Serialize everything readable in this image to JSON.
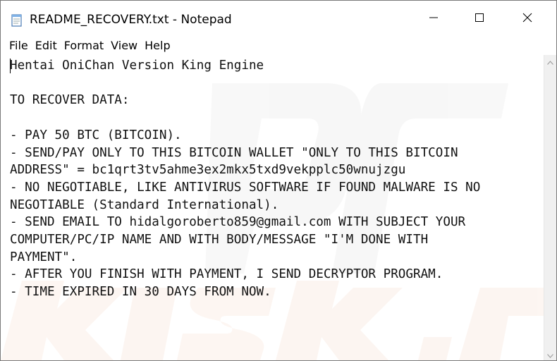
{
  "window": {
    "title": "README_RECOVERY.txt - Notepad",
    "app_icon": "notepad-icon",
    "controls": [
      "minimize-icon",
      "maximize-icon",
      "close-icon"
    ]
  },
  "menu": {
    "items": [
      "File",
      "Edit",
      "Format",
      "View",
      "Help"
    ]
  },
  "document": {
    "lines": [
      "Hentai OniChan Version King Engine",
      "",
      "TO RECOVER DATA:",
      "",
      "- PAY 50 BTC (BITCOIN).",
      "- SEND/PAY ONLY TO THIS BITCOIN WALLET \"ONLY TO THIS BITCOIN",
      "ADDRESS\" = bc1qrt3tv5ahme3ex2mkx5txd9vekpplc50wnujzgu",
      "- NO NEGOTIABLE, LIKE ANTIVIRUS SOFTWARE IF FOUND MALWARE IS NO",
      "NEGOTIABLE (Standard International).",
      "- SEND EMAIL TO hidalgoroberto859@gmail.com WITH SUBJECT YOUR",
      "COMPUTER/PC/IP NAME AND WITH BODY/MESSAGE \"I'M DONE WITH",
      "PAYMENT\".",
      "- AFTER YOU FINISH WITH PAYMENT, I SEND DECRYPTOR PROGRAM.",
      "- TIME EXPIRED IN 30 DAYS FROM NOW."
    ]
  },
  "scrollbar": {
    "up_icon": "scroll-up-arrow-icon",
    "down_icon": "scroll-down-arrow-icon"
  }
}
